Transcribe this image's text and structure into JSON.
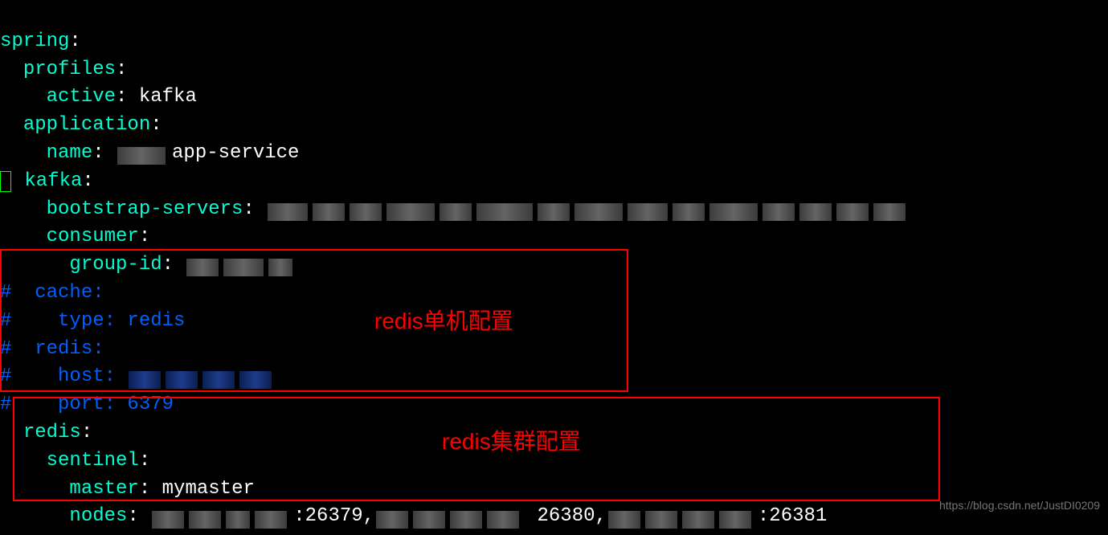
{
  "code": {
    "l1_key": "spring",
    "l2_key": "profiles",
    "l3_key": "active",
    "l3_val": "kafka",
    "l4_key": "application",
    "l5_key": "name",
    "l5_val": "app-service",
    "l6_key": "kafka",
    "l7_key": "bootstrap-servers",
    "l8_key": "consumer",
    "l9_key": "group-id",
    "l10": "#  cache:",
    "l11": "#    type: redis",
    "l12": "#  redis:",
    "l13": "#    host:",
    "l14": "#    port: 6379",
    "l15_key": "redis",
    "l16_key": "sentinel",
    "l17_key": "master",
    "l17_val": "mymaster",
    "l18_key": "nodes",
    "l18_p1": ":26379,",
    "l18_p2": "26380,",
    "l18_p3": ":26381"
  },
  "annotations": {
    "box1_label": "redis单机配置",
    "box2_label": "redis集群配置"
  },
  "watermark": "https://blog.csdn.net/JustDI0209"
}
